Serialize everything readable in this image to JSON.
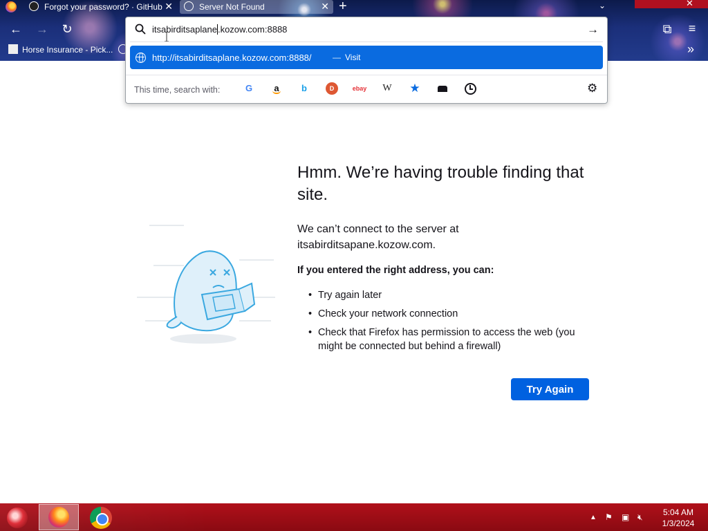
{
  "browser": {
    "tabs": [
      {
        "title": "Forgot your password? · GitHub"
      },
      {
        "title": "Server Not Found"
      }
    ],
    "bookmark": "Horse Insurance - Pick..."
  },
  "urlbar": {
    "value_before_caret": "itsabirditsaplane",
    "value_after_caret": ".kozow.com:8888",
    "suggestion_url": "http://itsabirditsaplane.kozow.com:8888/",
    "suggestion_dash": "—",
    "suggestion_action": "Visit",
    "search_with_label": "This time, search with:",
    "engines": {
      "google": "G",
      "amazon": "a",
      "bing": "b",
      "duckduckgo": "D",
      "ebay": "ebay",
      "wikipedia": "W"
    }
  },
  "error": {
    "title": "Hmm. We’re having trouble finding that site.",
    "description": "We can’t connect to the server at itsabirditsapane.kozow.com.",
    "subheading": "If you entered the right address, you can:",
    "suggestions": [
      "Try again later",
      "Check your network connection",
      "Check that Firefox has permission to access the web (you might be connected but behind a firewall)"
    ],
    "button": "Try Again"
  },
  "taskbar": {
    "time": "5:04 AM",
    "date": "1/3/2024"
  },
  "colors": {
    "accent": "#0061e0",
    "suggest_highlight": "#0a6be0",
    "taskbar": "#a00d16"
  }
}
